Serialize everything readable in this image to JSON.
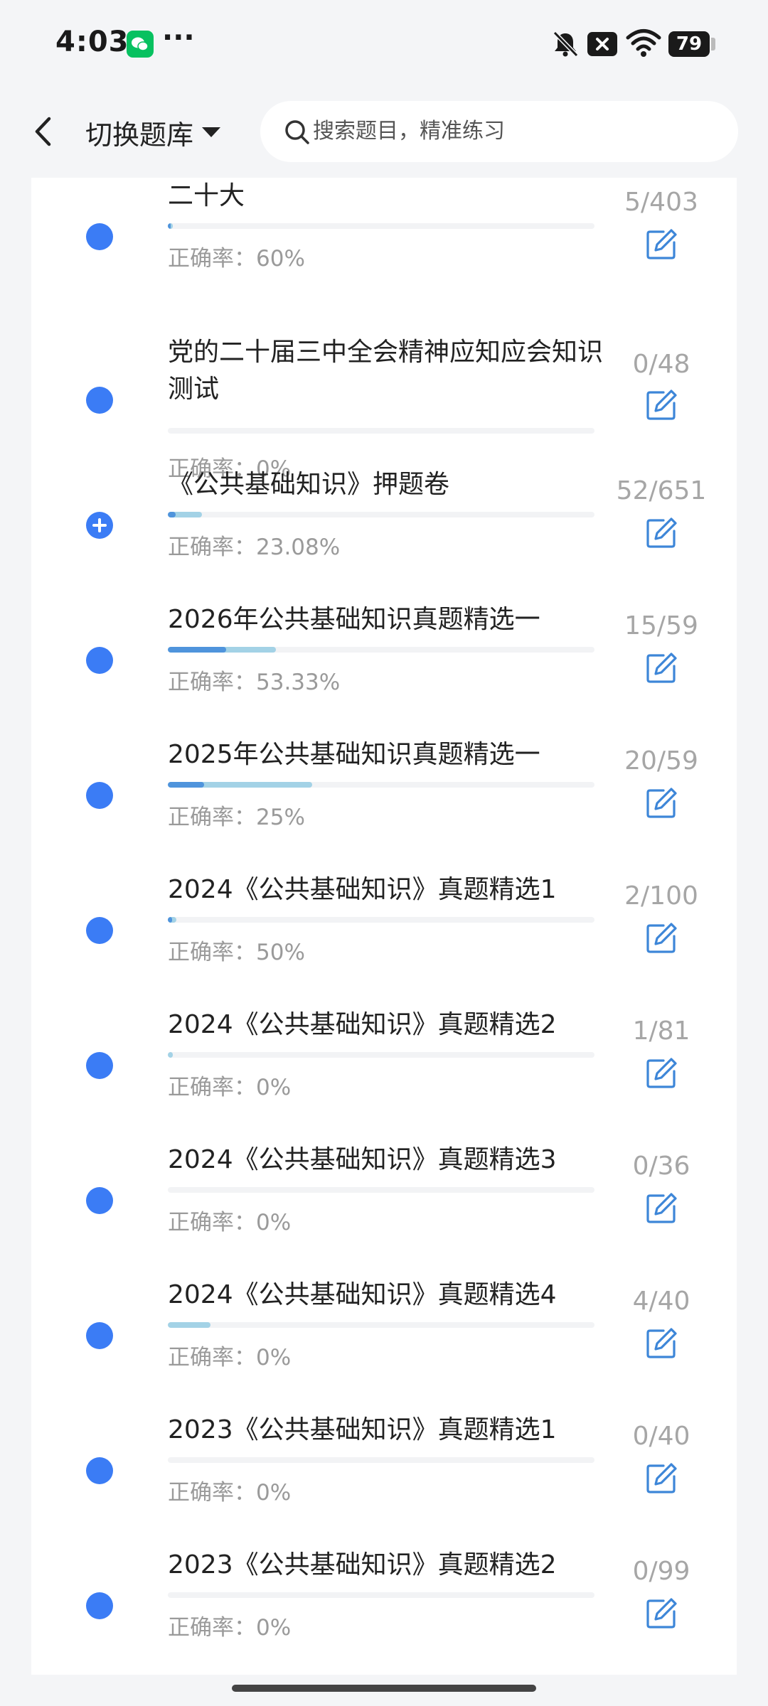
{
  "status_bar": {
    "time": "4:03",
    "dots": "···",
    "battery": "79"
  },
  "header": {
    "library_switch_label": "切换题库",
    "search_placeholder": "搜索题目，精准练习"
  },
  "colors": {
    "accent": "#3b7cf5",
    "bar_correct": "#4f94dc",
    "bar_attempted": "#a3d2e6",
    "edit_icon": "#3d86d8"
  },
  "items": [
    {
      "title": "二十大",
      "count": "5/403",
      "accuracy": "正确率：60%",
      "done_fraction": 0.012,
      "correct_fraction": 0.007,
      "icon": "dot"
    },
    {
      "title": "党的二十届三中全会精神应知应会知识测试",
      "count": "0/48",
      "accuracy": "正确率：0%",
      "done_fraction": 0,
      "correct_fraction": 0,
      "icon": "dot"
    },
    {
      "title": "《公共基础知识》押题卷",
      "count": "52/651",
      "accuracy": "正确率：23.08%",
      "done_fraction": 0.08,
      "correct_fraction": 0.018,
      "icon": "plus-circle"
    },
    {
      "title": "2026年公共基础知识真题精选一",
      "count": "15/59",
      "accuracy": "正确率：53.33%",
      "done_fraction": 0.254,
      "correct_fraction": 0.136,
      "icon": "dot"
    },
    {
      "title": "2025年公共基础知识真题精选一",
      "count": "20/59",
      "accuracy": "正确率：25%",
      "done_fraction": 0.339,
      "correct_fraction": 0.085,
      "icon": "dot"
    },
    {
      "title": "2024《公共基础知识》真题精选1",
      "count": "2/100",
      "accuracy": "正确率：50%",
      "done_fraction": 0.02,
      "correct_fraction": 0.01,
      "icon": "dot"
    },
    {
      "title": "2024《公共基础知识》真题精选2",
      "count": "1/81",
      "accuracy": "正确率：0%",
      "done_fraction": 0.012,
      "correct_fraction": 0,
      "icon": "dot"
    },
    {
      "title": "2024《公共基础知识》真题精选3",
      "count": "0/36",
      "accuracy": "正确率：0%",
      "done_fraction": 0,
      "correct_fraction": 0,
      "icon": "dot"
    },
    {
      "title": "2024《公共基础知识》真题精选4",
      "count": "4/40",
      "accuracy": "正确率：0%",
      "done_fraction": 0.1,
      "correct_fraction": 0,
      "icon": "dot"
    },
    {
      "title": "2023《公共基础知识》真题精选1",
      "count": "0/40",
      "accuracy": "正确率：0%",
      "done_fraction": 0,
      "correct_fraction": 0,
      "icon": "dot"
    },
    {
      "title": "2023《公共基础知识》真题精选2",
      "count": "0/99",
      "accuracy": "正确率：0%",
      "done_fraction": 0,
      "correct_fraction": 0,
      "icon": "dot"
    }
  ]
}
